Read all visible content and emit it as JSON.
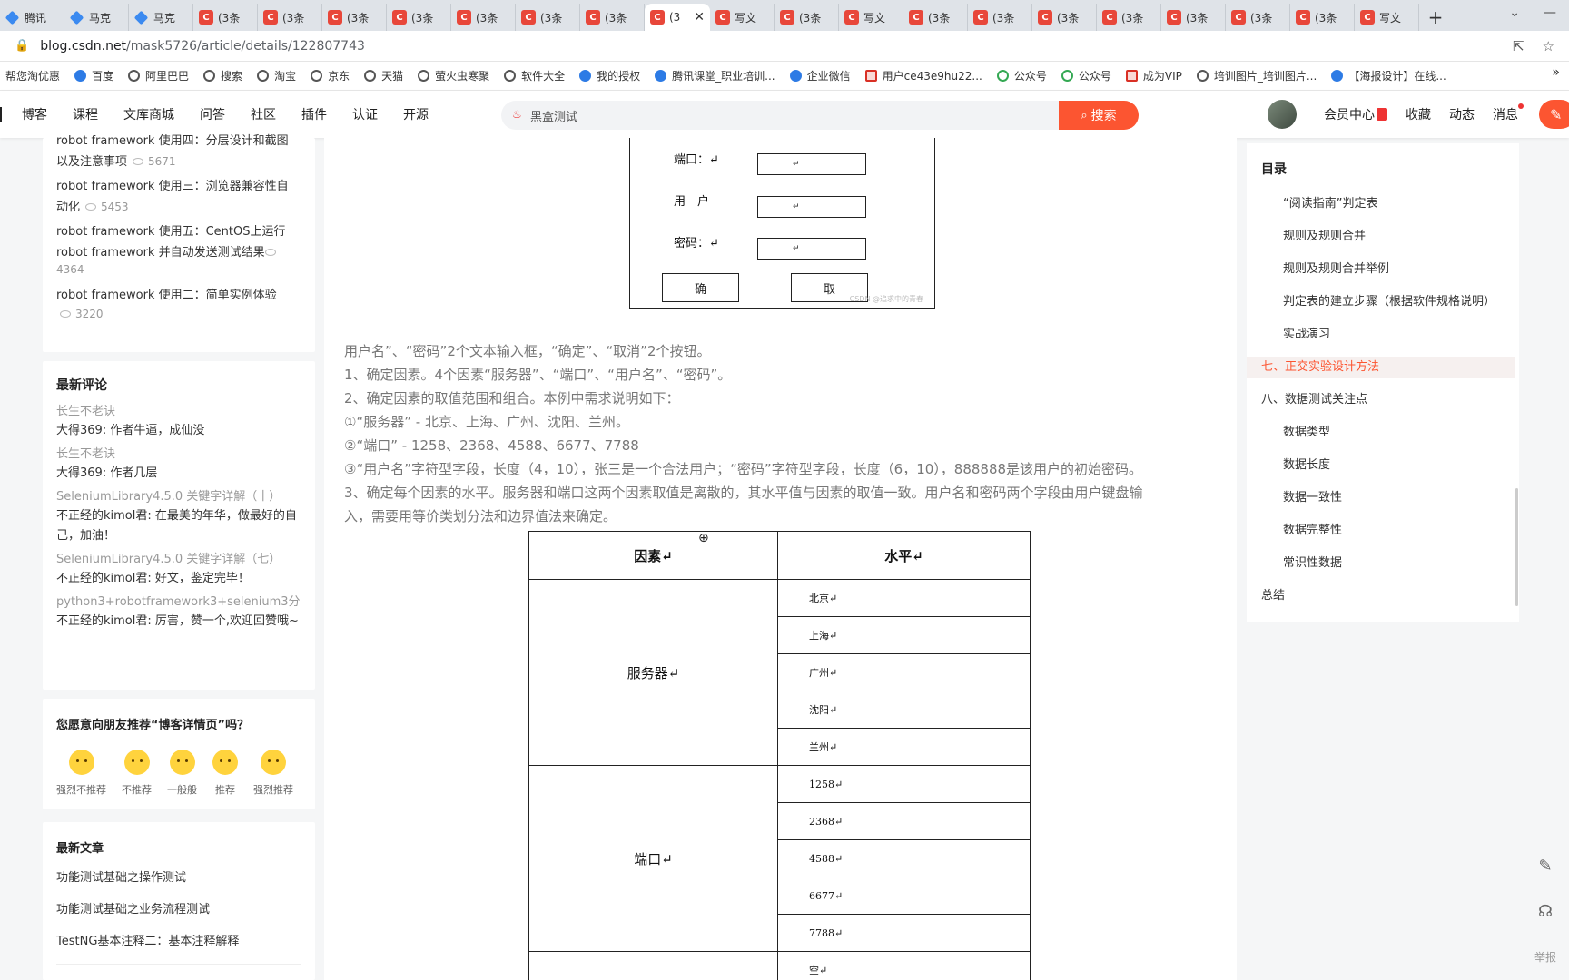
{
  "tabs": [
    {
      "label": "腾讯",
      "icon": "b"
    },
    {
      "label": "马克",
      "icon": "b"
    },
    {
      "label": "马克",
      "icon": "b"
    },
    {
      "label": "(3条",
      "icon": "c"
    },
    {
      "label": "(3条",
      "icon": "c"
    },
    {
      "label": "(3条",
      "icon": "c"
    },
    {
      "label": "(3条",
      "icon": "c"
    },
    {
      "label": "(3条",
      "icon": "c"
    },
    {
      "label": "(3条",
      "icon": "c"
    },
    {
      "label": "(3条",
      "icon": "c"
    },
    {
      "label": "(3",
      "icon": "c",
      "active": true
    },
    {
      "label": "写文",
      "icon": "c"
    },
    {
      "label": "(3条",
      "icon": "c"
    },
    {
      "label": "写文",
      "icon": "c"
    },
    {
      "label": "(3条",
      "icon": "c"
    },
    {
      "label": "(3条",
      "icon": "c"
    },
    {
      "label": "(3条",
      "icon": "c"
    },
    {
      "label": "(3条",
      "icon": "c"
    },
    {
      "label": "(3条",
      "icon": "c"
    },
    {
      "label": "(3条",
      "icon": "c"
    },
    {
      "label": "(3条",
      "icon": "c"
    },
    {
      "label": "写文",
      "icon": "c"
    }
  ],
  "address": {
    "host": "blog.csdn.net",
    "path": "/mask5726/article/details/122807743"
  },
  "bookmarks": [
    "帮您淘优惠",
    "百度",
    "阿里巴巴",
    "搜索",
    "淘宝",
    "京东",
    "天猫",
    "萤火虫寒聚",
    "软件大全",
    "我的授权",
    "腾讯课堂_职业培训...",
    "企业微信",
    "用户ce43e9hu22...",
    "公众号",
    "公众号",
    "成为VIP",
    "培训图片_培训图片...",
    "【海报设计】在线..."
  ],
  "nav": {
    "items": [
      "博客",
      "课程",
      "文库商城",
      "问答",
      "社区",
      "插件",
      "认证",
      "开源"
    ],
    "search_value": "黑盒测试",
    "search_button": "搜索",
    "right": [
      "会员中心",
      "收藏",
      "动态",
      "消息"
    ]
  },
  "left": {
    "top_articles": [
      {
        "title_lines": [
          "robot framework 使用四：分层设计和截图",
          "以及注意事项"
        ],
        "views": "5671"
      },
      {
        "title_lines": [
          "robot framework 使用三：浏览器兼容性自",
          "动化"
        ],
        "views": "5453"
      },
      {
        "title_lines": [
          "robot framework 使用五：CentOS上运行",
          "robot framework 并自动发送测试结果"
        ],
        "views": "4364"
      },
      {
        "title_lines": [
          "robot framework 使用二：简单实例体验"
        ],
        "views": "3220"
      }
    ],
    "comments_title": "最新评论",
    "comments": [
      {
        "article": "长生不老诀",
        "text": "大得369: 作者牛逼，成仙没"
      },
      {
        "article": "长生不老诀",
        "text": "大得369: 作者几层"
      },
      {
        "article": "SeleniumLibrary4.5.0 关键字详解（十）",
        "text": "不正经的kimol君: 在最美的年华，做最好的自己，加油！"
      },
      {
        "article": "SeleniumLibrary4.5.0 关键字详解（七）",
        "text": "不正经的kimol君: 好文，鉴定完毕！"
      },
      {
        "article": "python3+robotframework3+selenium3分...",
        "text": "不正经的kimol君: 厉害，赞一个,欢迎回赞哦~"
      }
    ],
    "recommend_title": "您愿意向朋友推荐“博客详情页”吗？",
    "recommend": [
      "强烈不推荐",
      "不推荐",
      "一般般",
      "推荐",
      "强烈推荐"
    ],
    "latest_title": "最新文章",
    "latest": [
      "功能测试基础之操作测试",
      "功能测试基础之业务流程测试",
      "TestNG基本注释二：基本注释解释"
    ]
  },
  "article": {
    "figure": {
      "labels": [
        "端口：↵",
        "用　户",
        "密码：↵"
      ],
      "box_mark": "↵",
      "buttons": [
        "确",
        "取"
      ],
      "watermark": "CSDN @追求中的青春"
    },
    "paragraphs": [
      "用户名”、“密码”2个文本输入框，“确定”、“取消”2个按钮。",
      "1、确定因素。4个因素“服务器”、“端口”、“用户名”、“密码”。",
      "2、确定因素的取值范围和组合。本例中需求说明如下：",
      "①“服务器” - 北京、上海、广州、沈阳、兰州。",
      "②“端口” - 1258、2368、4588、6677、7788",
      "③“用户名”字符型字段，长度（4，10），张三是一个合法用户；“密码”字符型字段，长度（6，10），888888是该用户的初始密码。",
      "3、确定每个因素的水平。服务器和端口这两个因素取值是离散的，其水平值与因素的取值一致。用户名和密码两个字段由用户键盘输",
      "入，需要用等价类划分法和边界值法来确定。"
    ],
    "table": {
      "headers": [
        "因素↵",
        "水平↵"
      ],
      "groups": [
        {
          "factor": "服务器↵",
          "levels": [
            "北京↵",
            "上海↵",
            "广州↵",
            "沈阳↵",
            "兰州↵"
          ]
        },
        {
          "factor": "端口↵",
          "levels": [
            "1258↵",
            "2368↵",
            "4588↵",
            "6677↵",
            "7788↵"
          ]
        },
        {
          "factor": "",
          "levels": [
            "空↵"
          ]
        }
      ]
    }
  },
  "toc": {
    "title": "目录",
    "items": [
      {
        "label": "“阅读指南”判定表",
        "sub": true
      },
      {
        "label": "规则及规则合并",
        "sub": true
      },
      {
        "label": "规则及规则合并举例",
        "sub": true
      },
      {
        "label": "判定表的建立步骤（根据软件规格说明）",
        "sub": true
      },
      {
        "label": "实战演习",
        "sub": true
      },
      {
        "label": "七、正交实验设计方法",
        "sub": false,
        "active": true
      },
      {
        "label": "八、数据测试关注点",
        "sub": false
      },
      {
        "label": "数据类型",
        "sub": true
      },
      {
        "label": "数据长度",
        "sub": true
      },
      {
        "label": "数据一致性",
        "sub": true
      },
      {
        "label": "数据完整性",
        "sub": true
      },
      {
        "label": "常识性数据",
        "sub": true
      },
      {
        "label": "总结",
        "sub": false
      }
    ]
  },
  "float_tools": {
    "report_label": "举报"
  },
  "colors": {
    "accent": "#fc5531",
    "toc_active": "#fc5531"
  }
}
